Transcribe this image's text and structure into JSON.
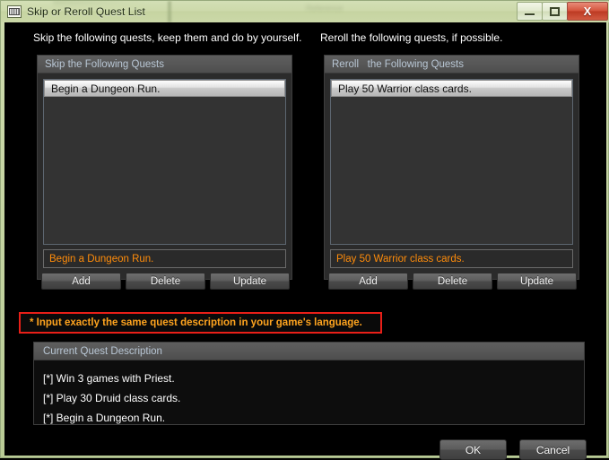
{
  "window": {
    "title": "Skip or Reroll Quest List",
    "icon": "grid-icon",
    "controls": {
      "minimize": "minimize-icon",
      "maximize": "maximize-icon",
      "close": "X"
    }
  },
  "main": {
    "instruction_left": "Skip the following quests, keep them and do by yourself.",
    "instruction_right": "Reroll the following quests, if possible.",
    "warning": "* Input exactly the same quest description in your game's language."
  },
  "skip_panel": {
    "header": "Skip the Following Quests",
    "list_items": [
      "Begin a Dungeon Run."
    ],
    "input_value": "Begin a Dungeon Run.",
    "buttons": {
      "add": "Add",
      "delete": "Delete",
      "update": "Update"
    }
  },
  "reroll_panel": {
    "header": "Reroll   the Following Quests",
    "list_items": [
      "Play 50 Warrior class cards."
    ],
    "input_value": "Play 50 Warrior class cards.",
    "buttons": {
      "add": "Add",
      "delete": "Delete",
      "update": "Update"
    }
  },
  "current_quest": {
    "header": "Current Quest Description",
    "lines": [
      "[*] Win 3 games with Priest.",
      "[*] Play 30 Druid class cards.",
      "[*] Begin a Dungeon Run."
    ]
  },
  "dialog_buttons": {
    "ok": "OK",
    "cancel": "Cancel"
  },
  "colors": {
    "accent_orange": "#ff8c0a",
    "warning_border": "#e81f18",
    "warning_text": "#ffa41f",
    "panel_header_text": "#b8c6d4",
    "titlebar_green": "#cddaab"
  }
}
